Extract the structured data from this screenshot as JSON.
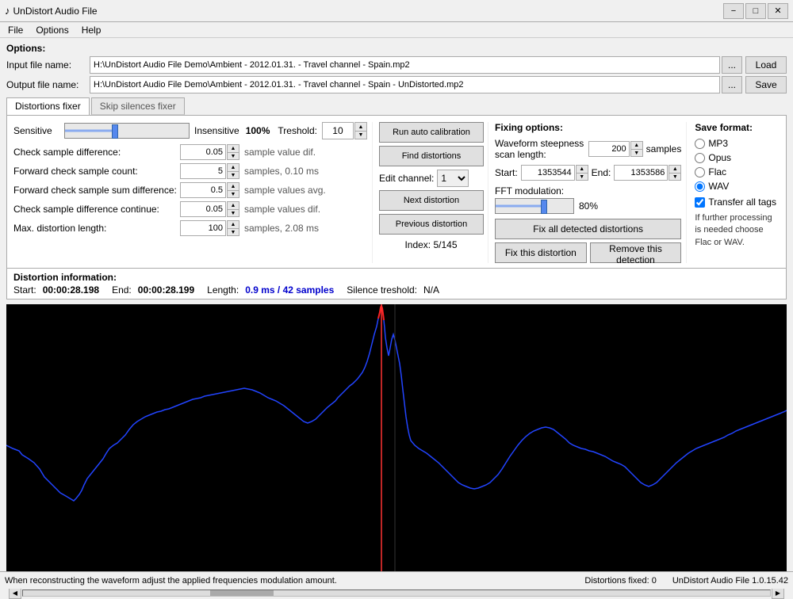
{
  "titleBar": {
    "icon": "♪",
    "title": "UnDistort Audio File",
    "minimize": "−",
    "maximize": "□",
    "close": "✕"
  },
  "menuBar": {
    "items": [
      "File",
      "Options",
      "Help"
    ]
  },
  "options": {
    "label": "Options:"
  },
  "inputFile": {
    "label": "Input file name:",
    "value": "H:\\UnDistort Audio File Demo\\Ambient - 2012.01.31. - Travel channel - Spain.mp2",
    "btnLabel": "...",
    "actionLabel": "Load"
  },
  "outputFile": {
    "label": "Output file name:",
    "value": "H:\\UnDistort Audio File Demo\\Ambient - 2012.01.31. - Travel channel - Spain - UnDistorted.mp2",
    "btnLabel": "...",
    "actionLabel": "Save"
  },
  "tabs": {
    "items": [
      "Distortions fixer",
      "Skip silences fixer"
    ],
    "active": 0
  },
  "distortionsFixer": {
    "sensitive": {
      "label": "Sensitive",
      "insensitiveLabel": "Insensitive",
      "percent": "100%",
      "thresholdLabel": "Treshold:",
      "thresholdValue": "10"
    },
    "formRows": [
      {
        "label": "Check sample difference:",
        "value": "0.05",
        "unit": "sample value dif."
      },
      {
        "label": "Forward check sample count:",
        "value": "5",
        "unit": "samples, 0.10 ms"
      },
      {
        "label": "Forward check sample sum difference:",
        "value": "0.5",
        "unit": "sample values avg."
      },
      {
        "label": "Check sample difference continue:",
        "value": "0.05",
        "unit": "sample values dif."
      },
      {
        "label": "Max. distortion length:",
        "value": "100",
        "unit": "samples, 2.08 ms"
      }
    ],
    "buttons": {
      "runAutoCalibration": "Run auto calibration",
      "findDistortions": "Find distortions",
      "nextDistortion": "Next distortion",
      "previousDistortion": "Previous distortion"
    },
    "editChannel": {
      "label": "Edit channel:",
      "value": "1"
    },
    "index": "Index: 5/145"
  },
  "fixingOptions": {
    "title": "Fixing options:",
    "waveformLabel": "Waveform steepness scan length:",
    "waveformValue": "200",
    "waveformUnit": "samples",
    "startLabel": "Start:",
    "startValue": "1353544",
    "endLabel": "End:",
    "endValue": "1353586",
    "fftLabel": "FFT modulation:",
    "fftPercent": "80%",
    "fixAllBtn": "Fix all detected distortions",
    "fixThisBtn": "Fix this distortion",
    "removeBtn": "Remove this detection"
  },
  "saveFormat": {
    "title": "Save format:",
    "options": [
      "MP3",
      "Opus",
      "Flac",
      "WAV"
    ],
    "selected": "WAV",
    "transferLabel": "Transfer all tags",
    "transferChecked": true,
    "note": "If further processing is needed choose Flac or WAV."
  },
  "distortionInfo": {
    "title": "Distortion information:",
    "startLabel": "Start:",
    "startValue": "00:00:28.198",
    "endLabel": "End:",
    "endValue": "00:00:28.199",
    "lengthLabel": "Length:",
    "lengthValue": "0.9 ms / 42 samples",
    "silenceLabel": "Silence treshold:",
    "silenceValue": "N/A"
  },
  "statusBar": {
    "leftText": "When reconstructing the waveform adjust the applied frequencies modulation amount.",
    "distortionsFixed": "Distortions fixed: 0",
    "appVersion": "UnDistort Audio File 1.0.15.42"
  }
}
